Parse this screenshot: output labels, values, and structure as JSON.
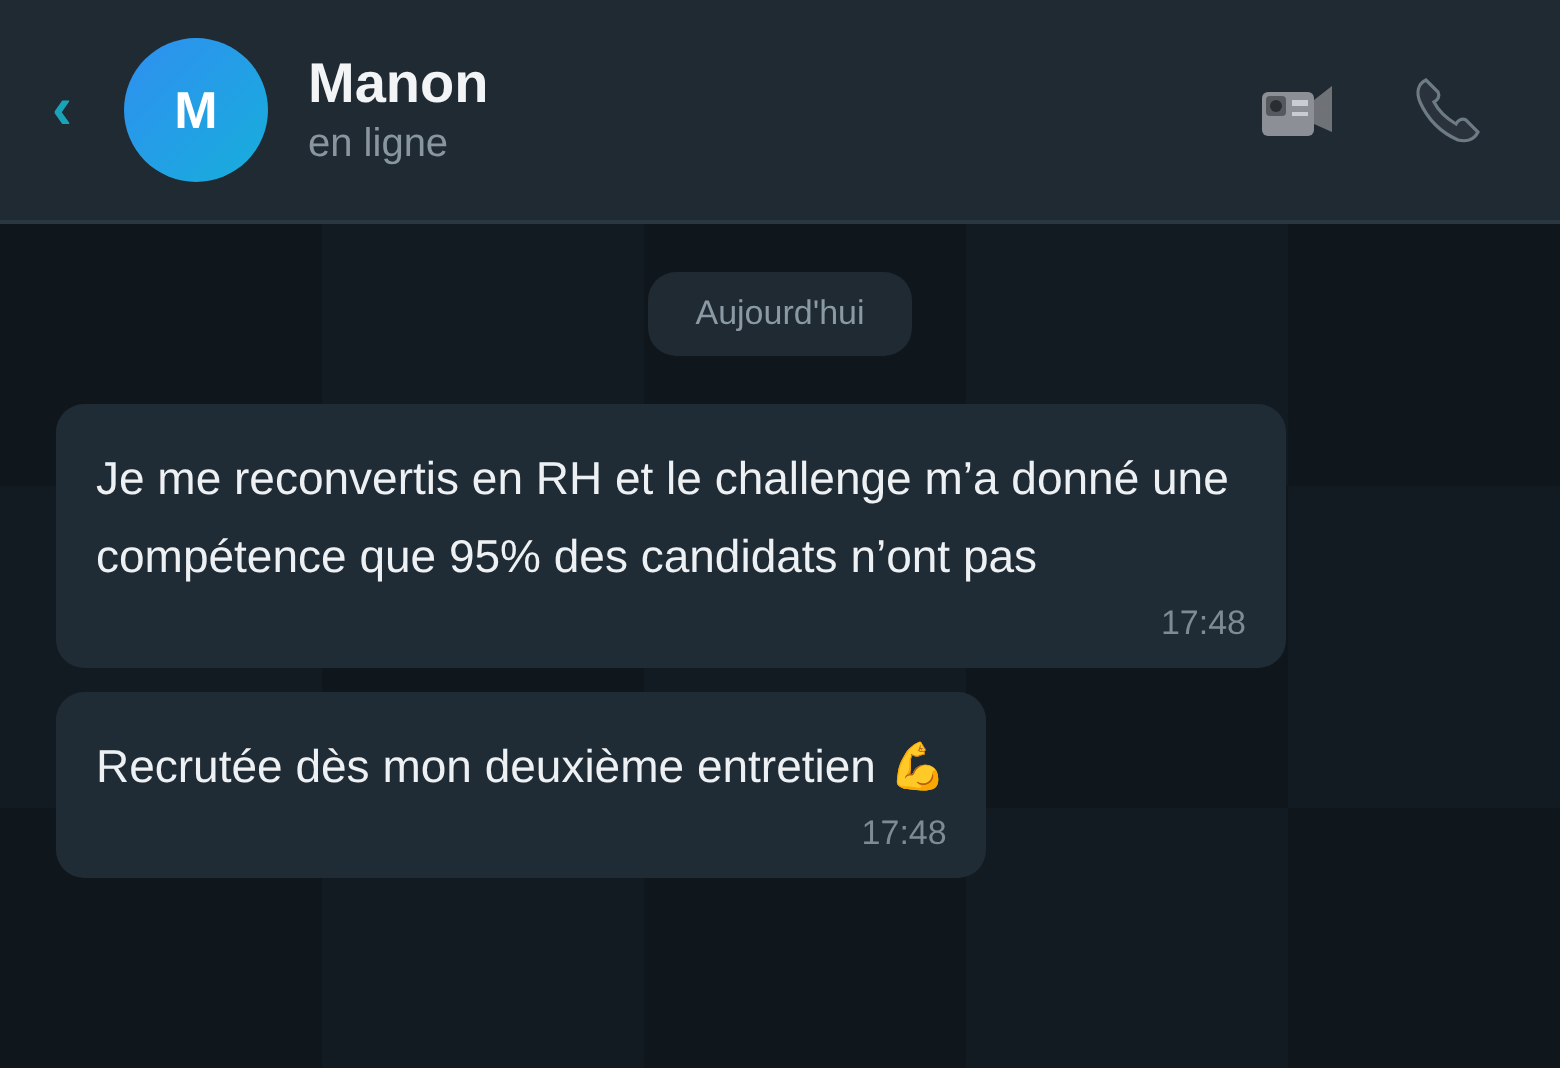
{
  "header": {
    "back": "‹",
    "avatar_initial": "M",
    "name": "Manon",
    "status": "en ligne"
  },
  "date_separator": "Aujourd'hui",
  "messages": [
    {
      "text": "Je me reconvertis en RH et le challenge m’a donné une compétence que 95% des candidats n’ont pas",
      "time": "17:48"
    },
    {
      "text": "Recrutée dès mon deuxième entretien 💪",
      "time": "17:48"
    }
  ]
}
